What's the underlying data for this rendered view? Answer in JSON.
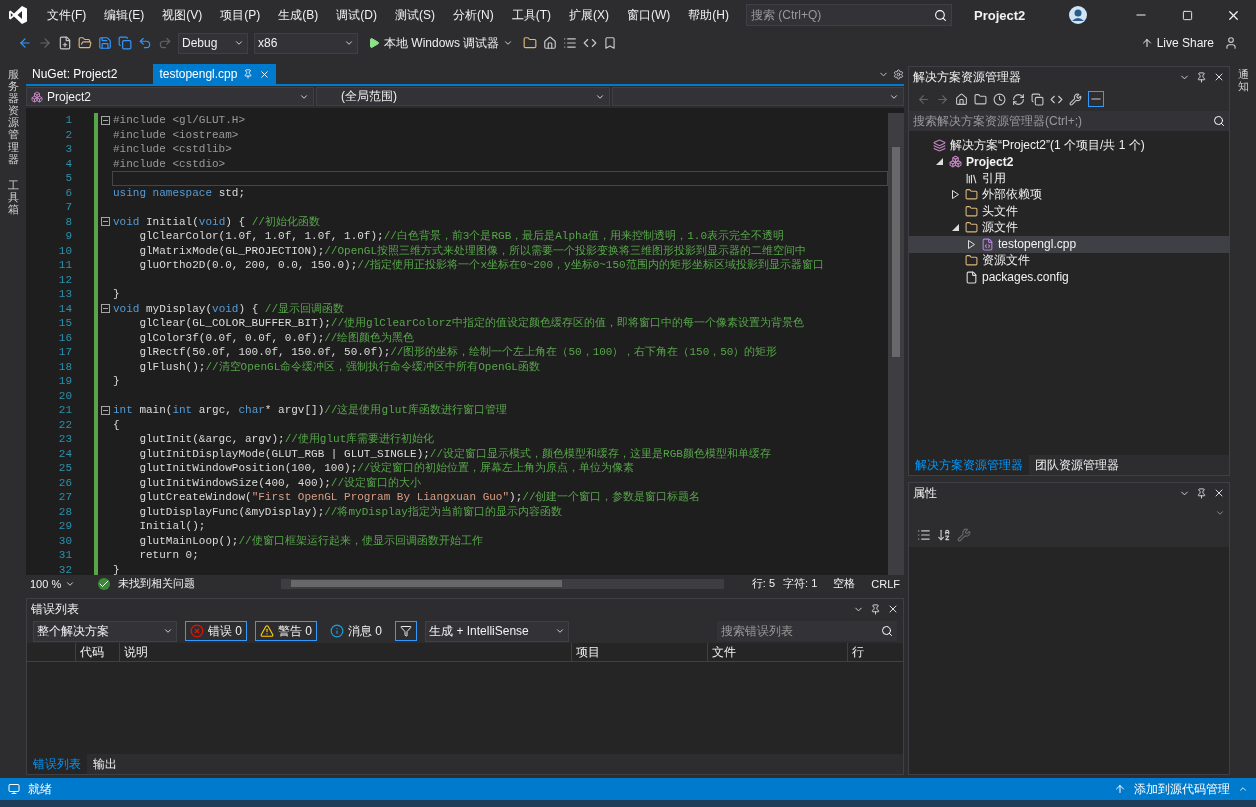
{
  "window": {
    "title": "Project2",
    "search_placeholder": "搜索 (Ctrl+Q)"
  },
  "menu": [
    "文件(F)",
    "编辑(E)",
    "视图(V)",
    "项目(P)",
    "生成(B)",
    "调试(D)",
    "测试(S)",
    "分析(N)",
    "工具(T)",
    "扩展(X)",
    "窗口(W)",
    "帮助(H)"
  ],
  "toolbar": {
    "configuration": "Debug",
    "platform": "x86",
    "run_label": "本地 Windows 调试器",
    "live_share": "Live Share"
  },
  "left_strip": [
    "服务器资源管理器",
    "工具箱"
  ],
  "right_strip": [
    "通知"
  ],
  "editor": {
    "tabs": [
      {
        "label": "NuGet: Project2",
        "selected": false
      },
      {
        "label": "testopengl.cpp",
        "selected": true
      }
    ],
    "nav": {
      "project": "Project2",
      "scope": "(全局范围)"
    },
    "lines": [
      {
        "number": "1",
        "collapsible": true,
        "current": false,
        "tokens": [
          {
            "kind": "pre",
            "text": "#include <gl/GLUT.H>"
          }
        ]
      },
      {
        "number": "2",
        "collapsible": false,
        "current": false,
        "tokens": [
          {
            "kind": "pre",
            "text": "#include <iostream>"
          }
        ]
      },
      {
        "number": "3",
        "collapsible": false,
        "current": false,
        "tokens": [
          {
            "kind": "pre",
            "text": "#include <cstdlib>"
          }
        ]
      },
      {
        "number": "4",
        "collapsible": false,
        "current": false,
        "tokens": [
          {
            "kind": "pre",
            "text": "#include <cstdio>"
          }
        ]
      },
      {
        "number": "5",
        "collapsible": false,
        "current": true
      },
      {
        "number": "6",
        "collapsible": false,
        "current": false,
        "tokens": [
          {
            "kind": "kw",
            "text": "using "
          },
          {
            "kind": "kw",
            "text": "namespace"
          },
          {
            "kind": "plain",
            "text": " std;"
          }
        ]
      },
      {
        "number": "7",
        "collapsible": false,
        "current": false
      },
      {
        "number": "8",
        "collapsible": true,
        "current": false,
        "tokens": [
          {
            "kind": "kw",
            "text": "void"
          },
          {
            "kind": "plain",
            "text": " Initial("
          },
          {
            "kind": "kw",
            "text": "void"
          },
          {
            "kind": "plain",
            "text": ") { "
          },
          {
            "kind": "comment",
            "text": "//初始化函数"
          }
        ]
      },
      {
        "number": "9",
        "collapsible": false,
        "current": false,
        "tokens": [
          {
            "kind": "plain",
            "text": "    glClearColor(1.0f, 1.0f, 1.0f, 1.0f);"
          },
          {
            "kind": "comment",
            "text": "//白色背景，前3个是RGB，最后是Alpha值，用来控制透明，1.0表示完全不透明"
          }
        ]
      },
      {
        "number": "10",
        "collapsible": false,
        "current": false,
        "tokens": [
          {
            "kind": "plain",
            "text": "    glMatrixMode(GL_PROJECTION);"
          },
          {
            "kind": "comment",
            "text": "//OpenGL按照三维方式来处理图像，所以需要一个投影变换将三维图形投影到显示器的二维空间中"
          }
        ]
      },
      {
        "number": "11",
        "collapsible": false,
        "current": false,
        "tokens": [
          {
            "kind": "plain",
            "text": "    gluOrtho2D(0.0, 200, 0.0, 150.0);"
          },
          {
            "kind": "comment",
            "text": "//指定使用正投影将一个x坐标在0~200，y坐标0~150范围内的矩形坐标区域投影到显示器窗口"
          }
        ]
      },
      {
        "number": "12",
        "collapsible": false,
        "current": false
      },
      {
        "number": "13",
        "collapsible": false,
        "current": false,
        "tokens": [
          {
            "kind": "plain",
            "text": "}"
          }
        ]
      },
      {
        "number": "14",
        "collapsible": true,
        "current": false,
        "tokens": [
          {
            "kind": "kw",
            "text": "void"
          },
          {
            "kind": "plain",
            "text": " myDisplay("
          },
          {
            "kind": "kw",
            "text": "void"
          },
          {
            "kind": "plain",
            "text": ") { "
          },
          {
            "kind": "comment",
            "text": "//显示回调函数"
          }
        ]
      },
      {
        "number": "15",
        "collapsible": false,
        "current": false,
        "tokens": [
          {
            "kind": "plain",
            "text": "    glClear(GL_COLOR_BUFFER_BIT);"
          },
          {
            "kind": "comment",
            "text": "//使用glClearColorz中指定的值设定颜色缓存区的值，即将窗口中的每一个像素设置为背景色"
          }
        ]
      },
      {
        "number": "16",
        "collapsible": false,
        "current": false,
        "tokens": [
          {
            "kind": "plain",
            "text": "    glColor3f(0.0f, 0.0f, 0.0f);"
          },
          {
            "kind": "comment",
            "text": "//绘图颜色为黑色"
          }
        ]
      },
      {
        "number": "17",
        "collapsible": false,
        "current": false,
        "tokens": [
          {
            "kind": "plain",
            "text": "    glRectf(50.0f, 100.0f, 150.0f, 50.0f);"
          },
          {
            "kind": "comment",
            "text": "//图形的坐标，绘制一个左上角在（50，100），右下角在（150，50）的矩形"
          }
        ]
      },
      {
        "number": "18",
        "collapsible": false,
        "current": false,
        "tokens": [
          {
            "kind": "plain",
            "text": "    glFlush();"
          },
          {
            "kind": "comment",
            "text": "//清空OpenGL命令缓冲区，强制执行命令缓冲区中所有OpenGL函数"
          }
        ]
      },
      {
        "number": "19",
        "collapsible": false,
        "current": false,
        "tokens": [
          {
            "kind": "plain",
            "text": "}"
          }
        ]
      },
      {
        "number": "20",
        "collapsible": false,
        "current": false
      },
      {
        "number": "21",
        "collapsible": true,
        "current": false,
        "tokens": [
          {
            "kind": "kw",
            "text": "int"
          },
          {
            "kind": "plain",
            "text": " main("
          },
          {
            "kind": "kw",
            "text": "int"
          },
          {
            "kind": "plain",
            "text": " argc, "
          },
          {
            "kind": "kw",
            "text": "char"
          },
          {
            "kind": "plain",
            "text": "* argv[])"
          },
          {
            "kind": "comment",
            "text": "//这是使用glut库函数进行窗口管理"
          }
        ]
      },
      {
        "number": "22",
        "collapsible": false,
        "current": false,
        "tokens": [
          {
            "kind": "plain",
            "text": "{"
          }
        ]
      },
      {
        "number": "23",
        "collapsible": false,
        "current": false,
        "tokens": [
          {
            "kind": "plain",
            "text": "    glutInit(&argc, argv);"
          },
          {
            "kind": "comment",
            "text": "//使用glut库需要进行初始化"
          }
        ]
      },
      {
        "number": "24",
        "collapsible": false,
        "current": false,
        "tokens": [
          {
            "kind": "plain",
            "text": "    glutInitDisplayMode(GLUT_RGB | GLUT_SINGLE);"
          },
          {
            "kind": "comment",
            "text": "//设定窗口显示模式，颜色模型和缓存，这里是RGB颜色模型和单缓存"
          }
        ]
      },
      {
        "number": "25",
        "collapsible": false,
        "current": false,
        "tokens": [
          {
            "kind": "plain",
            "text": "    glutInitWindowPosition(100, 100);"
          },
          {
            "kind": "comment",
            "text": "//设定窗口的初始位置，屏幕左上角为原点，单位为像素"
          }
        ]
      },
      {
        "number": "26",
        "collapsible": false,
        "current": false,
        "tokens": [
          {
            "kind": "plain",
            "text": "    glutInitWindowSize(400, 400);"
          },
          {
            "kind": "comment",
            "text": "//设定窗口的大小"
          }
        ]
      },
      {
        "number": "27",
        "collapsible": false,
        "current": false,
        "tokens": [
          {
            "kind": "plain",
            "text": "    glutCreateWindow("
          },
          {
            "kind": "str",
            "text": "\"First OpenGL Program By Liangxuan Guo\""
          },
          {
            "kind": "plain",
            "text": ");"
          },
          {
            "kind": "comment",
            "text": "//创建一个窗口，参数是窗口标题名"
          }
        ]
      },
      {
        "number": "28",
        "collapsible": false,
        "current": false,
        "tokens": [
          {
            "kind": "plain",
            "text": "    glutDisplayFunc(&myDisplay);"
          },
          {
            "kind": "comment",
            "text": "//将myDisplay指定为当前窗口的显示内容函数"
          }
        ]
      },
      {
        "number": "29",
        "collapsible": false,
        "current": false,
        "tokens": [
          {
            "kind": "plain",
            "text": "    Initial();"
          }
        ]
      },
      {
        "number": "30",
        "collapsible": false,
        "current": false,
        "tokens": [
          {
            "kind": "plain",
            "text": "    glutMainLoop();"
          },
          {
            "kind": "comment",
            "text": "//使窗口框架运行起来，使显示回调函数开始工作"
          }
        ]
      },
      {
        "number": "31",
        "collapsible": false,
        "current": false,
        "tokens": [
          {
            "kind": "plain",
            "text": "    return 0;"
          }
        ]
      },
      {
        "number": "32",
        "collapsible": false,
        "current": false,
        "tokens": [
          {
            "kind": "plain",
            "text": "}"
          }
        ]
      }
    ],
    "status": {
      "zoom": "100 %",
      "issues": "未找到相关问题",
      "line": "行: 5",
      "char": "字符: 1",
      "spacing": "空格",
      "eol": "CRLF"
    }
  },
  "error_list": {
    "title": "错误列表",
    "scope": "整个解决方案",
    "filters": [
      {
        "kind": "error",
        "label": "错误 0",
        "selected": true
      },
      {
        "kind": "warning",
        "label": "警告 0",
        "selected": true
      },
      {
        "kind": "message",
        "label": "消息 0",
        "selected": false
      }
    ],
    "source": "生成 + IntelliSense",
    "search_placeholder": "搜索错误列表",
    "columns": [
      "代码",
      "说明",
      "项目",
      "文件",
      "行"
    ],
    "tabs": [
      {
        "label": "错误列表",
        "selected": true
      },
      {
        "label": "输出",
        "selected": false
      }
    ]
  },
  "solution_explorer": {
    "title": "解决方案资源管理器",
    "search_placeholder": "搜索解决方案资源管理器(Ctrl+;)",
    "tree": [
      {
        "label": "解决方案“Project2”(1 个项目/共 1 个)",
        "kind": "solution",
        "selected": false,
        "children": [
          {
            "label": "Project2",
            "kind": "project",
            "expanded": true,
            "selected": false,
            "children": [
              {
                "label": "引用",
                "kind": "references",
                "selected": false
              },
              {
                "label": "外部依赖项",
                "kind": "external",
                "expanded": false,
                "selected": false
              },
              {
                "label": "头文件",
                "kind": "folder",
                "selected": false
              },
              {
                "label": "源文件",
                "kind": "folder",
                "expanded": true,
                "selected": false,
                "children": [
                  {
                    "label": "testopengl.cpp",
                    "kind": "cpp",
                    "expanded": false,
                    "selected": true
                  }
                ]
              },
              {
                "label": "资源文件",
                "kind": "folder",
                "selected": false
              },
              {
                "label": "packages.config",
                "kind": "config",
                "selected": false
              }
            ]
          }
        ]
      }
    ],
    "tabs": [
      {
        "label": "解决方案资源管理器",
        "selected": true
      },
      {
        "label": "团队资源管理器",
        "selected": false
      }
    ]
  },
  "properties": {
    "title": "属性"
  },
  "status_bar": {
    "text": "就绪",
    "source_control": "添加到源代码管理"
  }
}
